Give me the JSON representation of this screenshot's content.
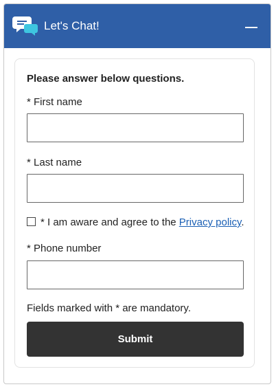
{
  "header": {
    "title": "Let's Chat!",
    "icon": "chat-bubbles-icon",
    "minimize_icon": "minimize-icon",
    "background_color": "#2f5fa7"
  },
  "form": {
    "intro": "Please answer below questions.",
    "first_name": {
      "label": "* First name",
      "value": "",
      "placeholder": ""
    },
    "last_name": {
      "label": "* Last name",
      "value": "",
      "placeholder": ""
    },
    "consent": {
      "checked": false,
      "text_before": "* I am aware and agree to the ",
      "link_text": "Privacy policy",
      "text_after": "."
    },
    "phone": {
      "label": "* Phone number",
      "value": "",
      "placeholder": ""
    },
    "mandatory_note": "Fields marked with * are mandatory.",
    "submit_label": "Submit"
  }
}
